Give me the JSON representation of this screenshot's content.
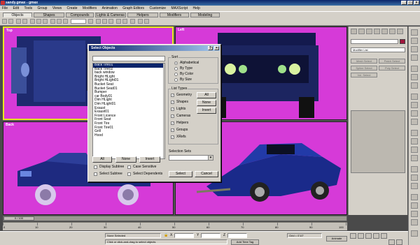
{
  "window": {
    "title": "sandy.gmax - gmax",
    "min": "_",
    "max": "□",
    "close": "×"
  },
  "menu": [
    "File",
    "Edit",
    "Tools",
    "Group",
    "Views",
    "Create",
    "Modifiers",
    "Animation",
    "Graph Editors",
    "Customize",
    "MAXScript",
    "Help"
  ],
  "tabs": [
    "Objects",
    "Shapes",
    "Compounds",
    "Lights & Cameras",
    "Helpers",
    "Modifiers",
    "Modeling"
  ],
  "viewports": {
    "top": "Top",
    "left": "Left",
    "back": "Back",
    "persp": ""
  },
  "command_panel": {
    "modifier_list": "Modifier List",
    "buttons": [
      "Mesh Select",
      "Patch Select",
      "Spline Select",
      "Poly Select",
      "Vol. Select"
    ]
  },
  "time": {
    "slider": "0 / 100",
    "ticks": [
      "0",
      "10",
      "20",
      "30",
      "40",
      "50",
      "60",
      "70",
      "80",
      "90",
      "100"
    ]
  },
  "status": {
    "selection": "None Selected",
    "prompt": "Click or click-and-drag to select objects",
    "x_label": "X",
    "y_label": "Y",
    "z_label": "Z",
    "lock_icon": "lock-icon",
    "grid": "Grid = 0'10\"",
    "add_time_tag": "Add Time Tag",
    "animate": "Animate"
  },
  "dialog": {
    "title": "Select Objects",
    "help": "?",
    "close": "×",
    "objects": [
      "Back Tire01",
      "Back Tire02",
      "back window",
      "Bright HLight",
      "Bright HLight01",
      "Bucket Seat",
      "Bucket Seat01",
      "Bumper",
      "car Body01",
      "Dim HLight",
      "Dim HLight01",
      "Exaust",
      "Exaust01",
      "Front Licence",
      "Front Seat",
      "Front Tire",
      "Front Tire01",
      "Grill",
      "Hood"
    ],
    "selected_index": 0,
    "sort": {
      "title": "Sort",
      "options": [
        "Alphabetical",
        "By Type",
        "By Color",
        "By Size"
      ],
      "selected": 0
    },
    "list_types": {
      "title": "List Types",
      "items": [
        "Geometry",
        "Shapes",
        "Lights",
        "Cameras",
        "Helpers",
        "Groups",
        "XRefs"
      ],
      "checked": [
        true,
        true,
        true,
        true,
        true,
        true,
        true
      ],
      "all": "All",
      "none": "None",
      "invert": "Invert"
    },
    "bottom": {
      "all": "All",
      "none": "None",
      "invert": "Invert"
    },
    "options": [
      "Display Subtree",
      "Case Sensitive",
      "Select Subtree",
      "Select Dependents"
    ],
    "selection_sets": "Selection Sets",
    "select": "Select",
    "cancel": "Cancel"
  }
}
